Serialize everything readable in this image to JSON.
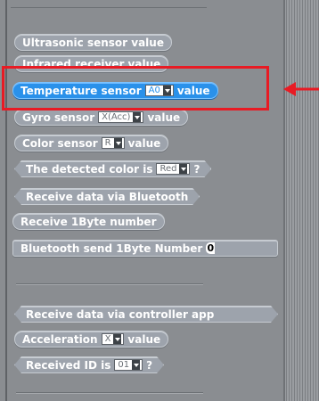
{
  "palette": {
    "blocks": [
      {
        "id": "ultrasonic",
        "label": "Ultrasonic sensor value"
      },
      {
        "id": "infrared",
        "label": "Infrared receiver value"
      },
      {
        "id": "temperature",
        "prefix": "Temperature sensor",
        "dropdown": "A0",
        "suffix": "value"
      },
      {
        "id": "gyro",
        "prefix": "Gyro sensor",
        "dropdown": "X(Acc)",
        "suffix": "value"
      },
      {
        "id": "color",
        "prefix": "Color sensor",
        "dropdown": "R",
        "suffix": "value"
      },
      {
        "id": "detected-color",
        "prefix": "The detected color is",
        "dropdown": "Red",
        "suffix": "?"
      },
      {
        "id": "receive-bt",
        "label": "Receive data via Bluetooth"
      },
      {
        "id": "receive-1byte",
        "label": "Receive 1Byte number"
      },
      {
        "id": "bt-send",
        "label": "Bluetooth send 1Byte Number",
        "slot": "0"
      },
      {
        "id": "receive-app",
        "label": "Receive data via controller app"
      },
      {
        "id": "acceleration",
        "prefix": "Acceleration",
        "dropdown": "X",
        "suffix": "value"
      },
      {
        "id": "received-id",
        "prefix": "Received ID is",
        "dropdown": "01",
        "suffix": "?"
      }
    ]
  },
  "colors": {
    "selected_block": "#2a91ea",
    "highlight": "#e81b24",
    "palette_bg": "#8a8d91"
  }
}
